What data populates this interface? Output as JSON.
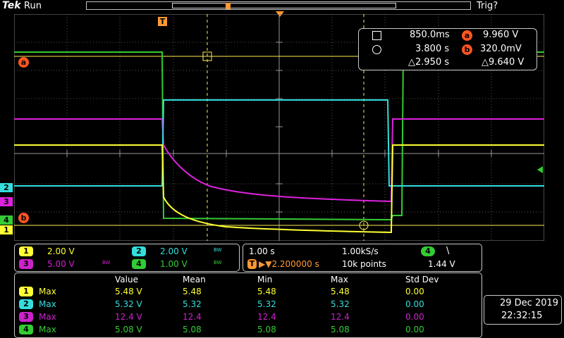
{
  "topbar": {
    "brand": "Tek",
    "run_state": "Run",
    "trigger_state": "Trig?"
  },
  "trigger_marker": "T",
  "channel_markers": {
    "ch1": "1",
    "ch2": "2",
    "ch3": "3",
    "ch4": "4",
    "cursor_a": "a",
    "cursor_b": "b"
  },
  "cursor_readout": {
    "time_a": "850.0ms",
    "time_b": "3.800 s",
    "delta_time": "△2.950 s",
    "badge_a": "a",
    "volt_a": "9.960 V",
    "badge_b": "b",
    "volt_b": "320.0mV",
    "delta_volt": "△9.640 V"
  },
  "channel_settings": [
    {
      "num": "1",
      "scale": "2.00 V",
      "color": "#ffff33"
    },
    {
      "num": "2",
      "scale": "2.00 V",
      "color": "#33dddd"
    },
    {
      "num": "3",
      "scale": "5.00 V",
      "color": "#dd22dd"
    },
    {
      "num": "4",
      "scale": "1.00 V",
      "color": "#33cc33"
    }
  ],
  "bw_label": "BW",
  "horizontal": {
    "scale": "1.00 s",
    "sample_rate": "1.00kS/s",
    "delay_badge": "T",
    "delay": "▶▼2.200000 s",
    "record_length": "10k points",
    "trigger_channel": "4",
    "trigger_slope": "\\",
    "trigger_level": "1.44 V"
  },
  "measurements": {
    "headers": [
      "Value",
      "Mean",
      "Min",
      "Max",
      "Std Dev"
    ],
    "rows": [
      {
        "ch": "1",
        "type": "Max",
        "value": "5.48 V",
        "mean": "5.48",
        "min": "5.48",
        "max": "5.48",
        "std": "0.00",
        "color": "#ffff33"
      },
      {
        "ch": "2",
        "type": "Max",
        "value": "5.32 V",
        "mean": "5.32",
        "min": "5.32",
        "max": "5.32",
        "std": "0.00",
        "color": "#33dddd"
      },
      {
        "ch": "3",
        "type": "Max",
        "value": "12.4 V",
        "mean": "12.4",
        "min": "12.4",
        "max": "12.4",
        "std": "0.00",
        "color": "#cc22cc"
      },
      {
        "ch": "4",
        "type": "Max",
        "value": "5.08 V",
        "mean": "5.08",
        "min": "5.08",
        "max": "5.08",
        "std": "0.00",
        "color": "#33cc33"
      }
    ]
  },
  "datetime": {
    "date": "29 Dec  2019",
    "time": "22:32:15"
  },
  "colors": {
    "ch1": "#ffff33",
    "ch2": "#33dddd",
    "ch3": "#dd22dd",
    "ch4": "#33cc33",
    "cursor": "#ff5522",
    "trigger": "#ff9933"
  }
}
